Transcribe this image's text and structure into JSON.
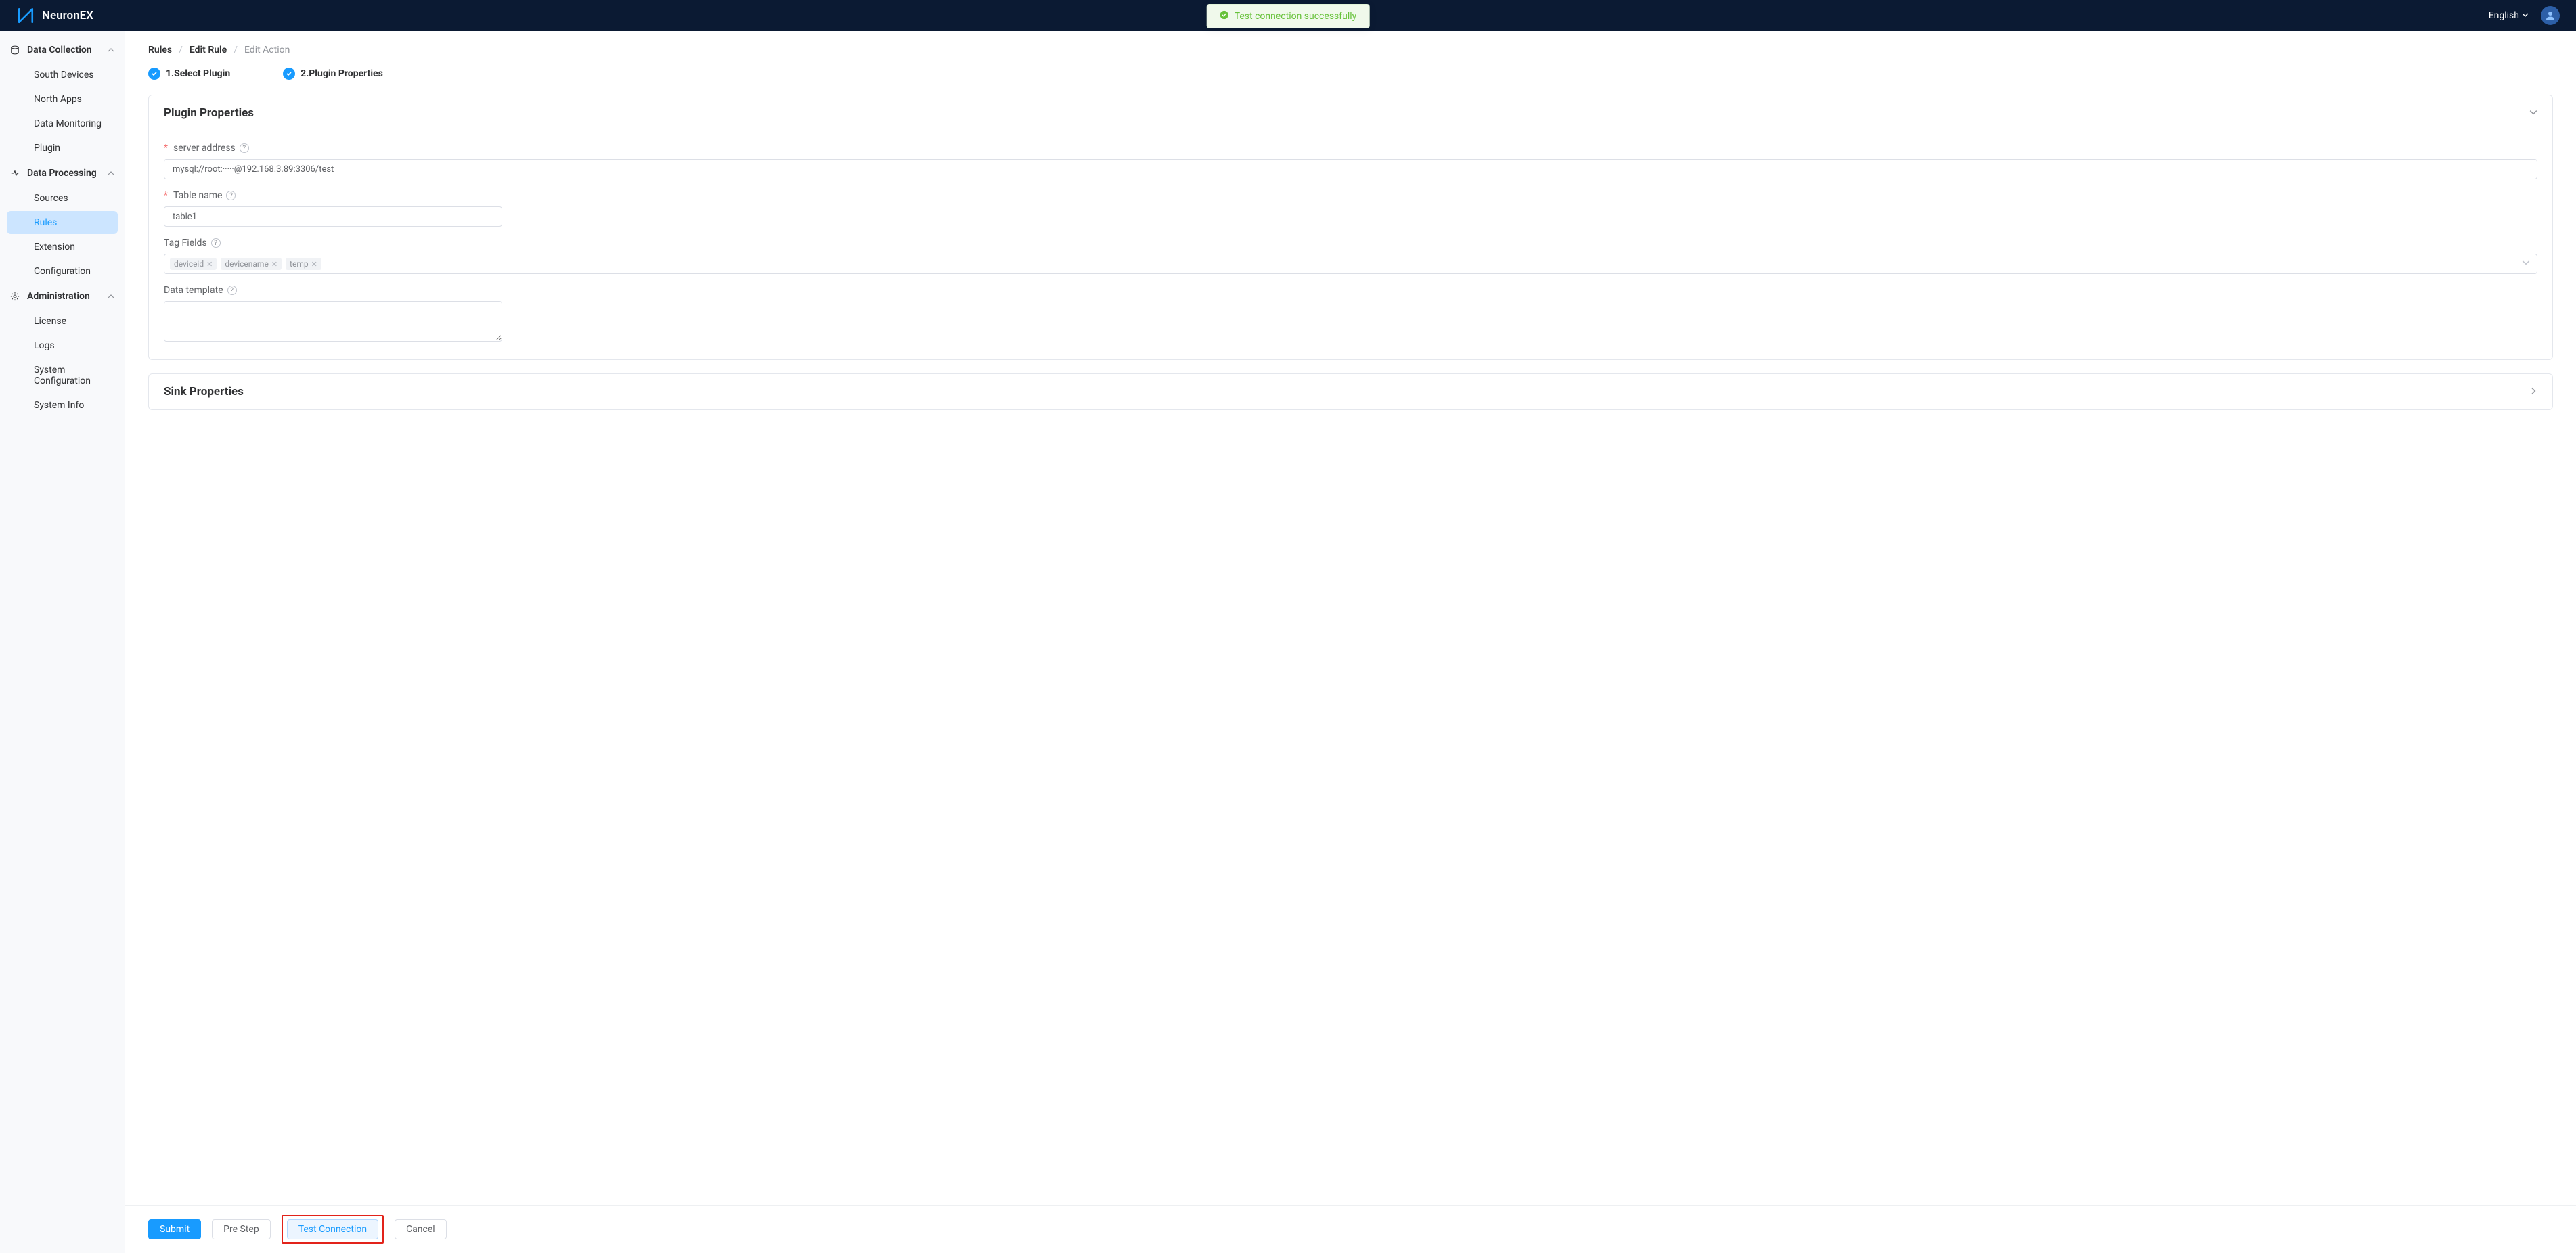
{
  "header": {
    "brand": "NeuronEX",
    "toast": "Test connection successfully",
    "language": "English"
  },
  "sidebar": {
    "groups": [
      {
        "label": "Data Collection",
        "items": [
          "South Devices",
          "North Apps",
          "Data Monitoring",
          "Plugin"
        ]
      },
      {
        "label": "Data Processing",
        "items": [
          "Sources",
          "Rules",
          "Extension",
          "Configuration"
        ],
        "activeIndex": 1
      },
      {
        "label": "Administration",
        "items": [
          "License",
          "Logs",
          "System Configuration",
          "System Info"
        ]
      }
    ]
  },
  "breadcrumb": {
    "a": "Rules",
    "b": "Edit Rule",
    "c": "Edit Action"
  },
  "steps": {
    "s1": "1.Select Plugin",
    "s2": "2.Plugin Properties"
  },
  "panel1": {
    "title": "Plugin Properties",
    "serverLabel": "server address",
    "serverValue": "mysql://root:·····@192.168.3.89:3306/test",
    "tableLabel": "Table name",
    "tableValue": "table1",
    "tagLabel": "Tag Fields",
    "tags": [
      "deviceid",
      "devicename",
      "temp"
    ],
    "tplLabel": "Data template",
    "tplValue": ""
  },
  "panel2": {
    "title": "Sink Properties"
  },
  "footer": {
    "submit": "Submit",
    "prev": "Pre Step",
    "test": "Test Connection",
    "cancel": "Cancel"
  }
}
